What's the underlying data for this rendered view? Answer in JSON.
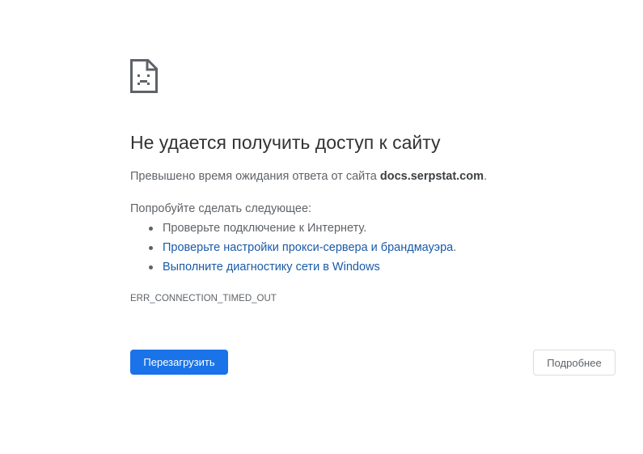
{
  "error_page": {
    "icon": "sad-page-icon",
    "title": "Не удается получить доступ к сайту",
    "summary_prefix": "Превышено время ожидания ответа от сайта ",
    "summary_host": "docs.serpstat.com",
    "summary_suffix": ".",
    "suggestions_heading": "Попробуйте сделать следующее:",
    "suggestions": [
      {
        "text": "Проверьте подключение к Интернету.",
        "is_link": false
      },
      {
        "text": "Проверьте настройки прокси-сервера и брандмауэра",
        "is_link": true,
        "trailing": "."
      },
      {
        "text": "Выполните диагностику сети в Windows",
        "is_link": true,
        "trailing": ""
      }
    ],
    "error_code": "ERR_CONNECTION_TIMED_OUT"
  },
  "buttons": {
    "reload_label": "Перезагрузить",
    "details_label": "Подробнее"
  },
  "colors": {
    "primary_button": "#1a73e8",
    "link": "#1a5aa8",
    "text": "#5f6368",
    "title": "#333333"
  }
}
